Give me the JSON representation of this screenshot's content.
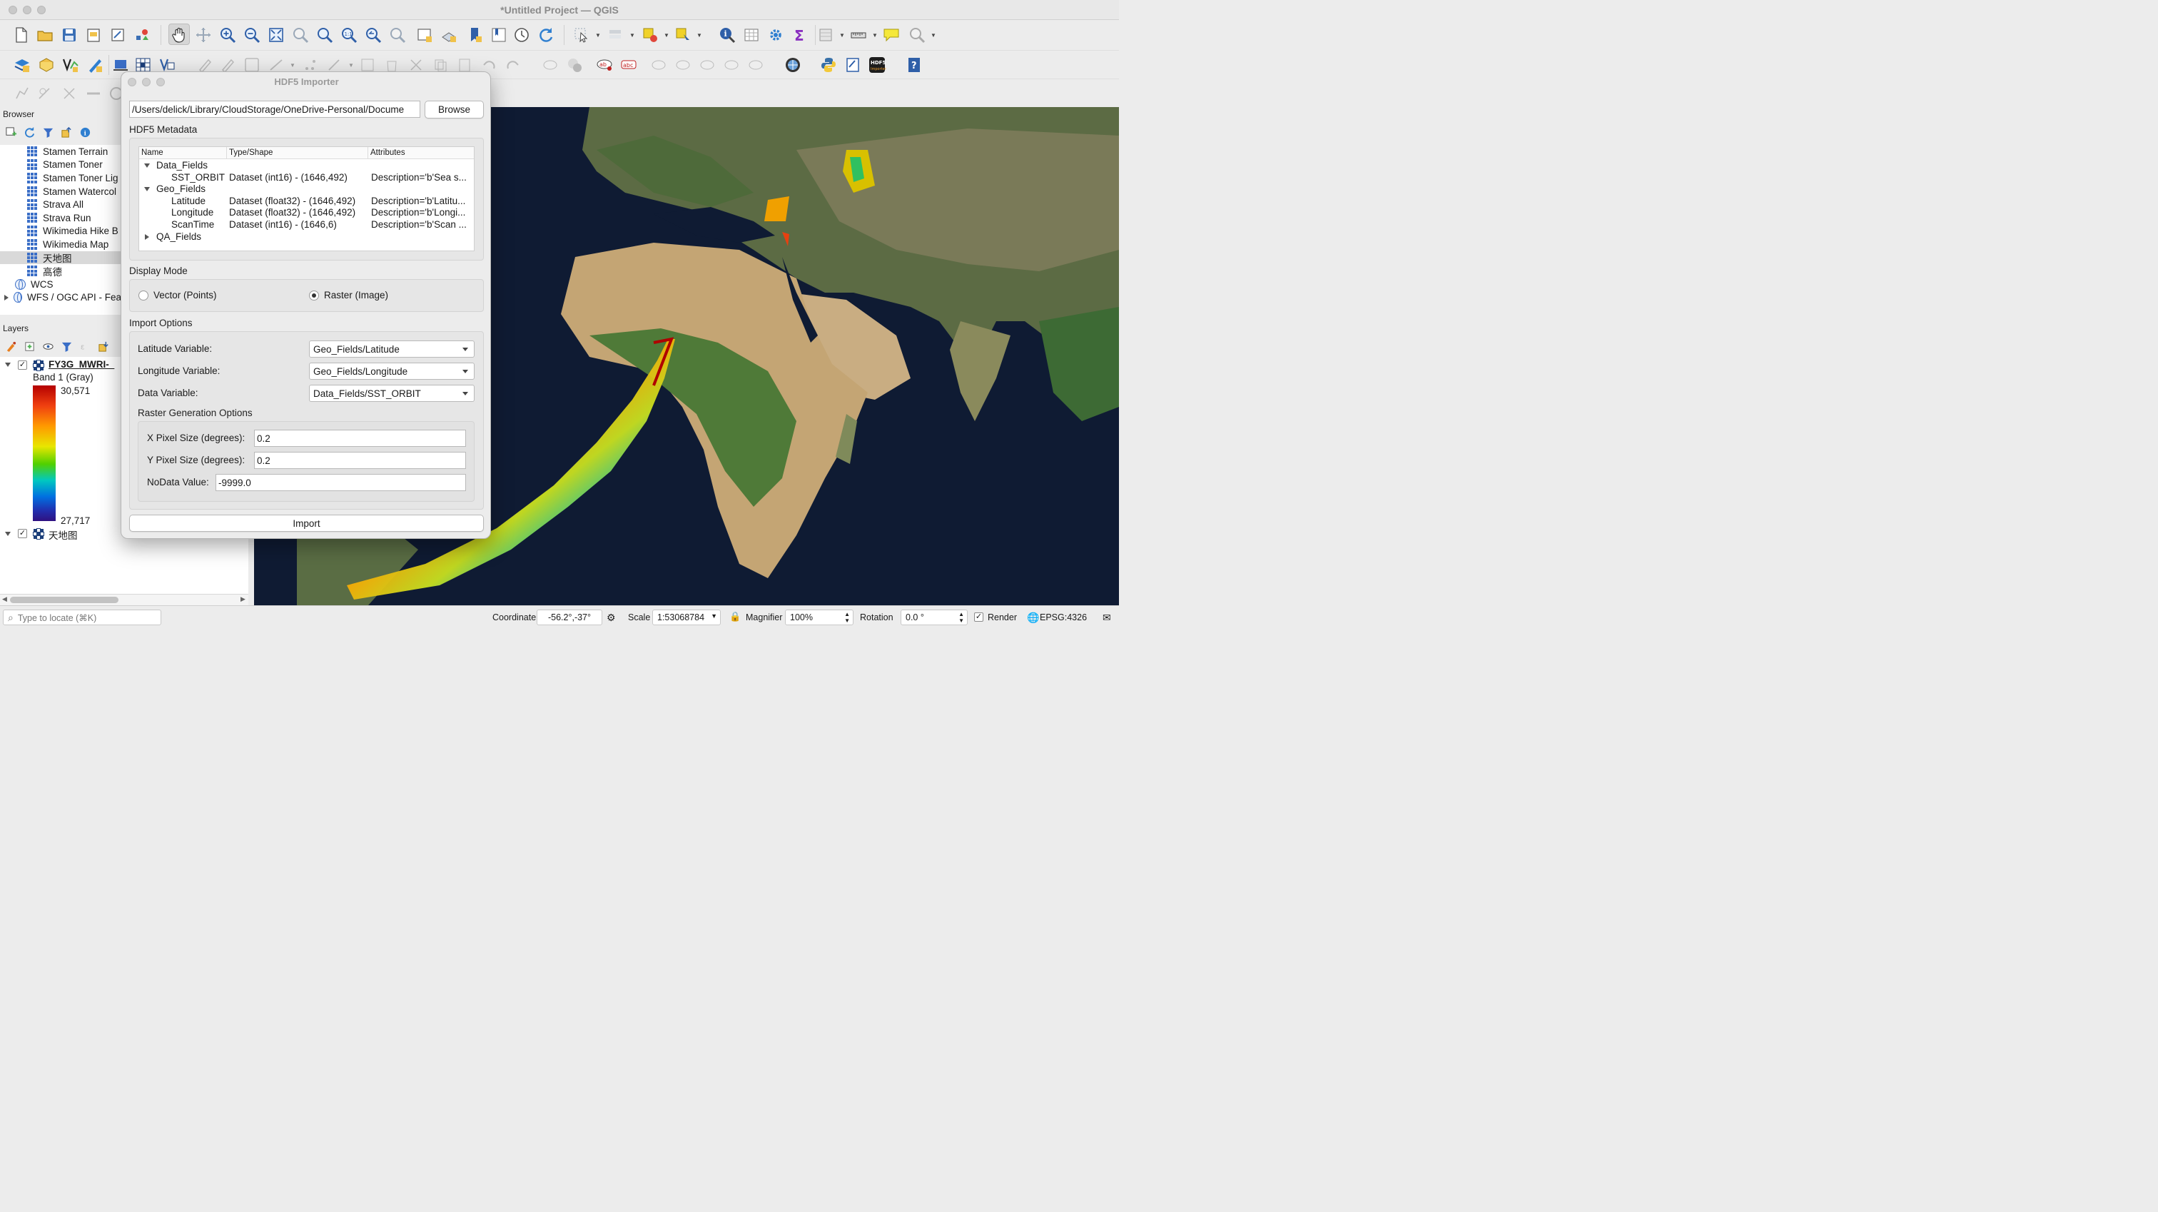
{
  "window": {
    "title": "*Untitled Project — QGIS"
  },
  "panels": {
    "browser": {
      "title": "Browser",
      "items": [
        {
          "label": "Stamen Terrain",
          "icon": "xyz-grid-icon"
        },
        {
          "label": "Stamen Toner",
          "icon": "xyz-grid-icon"
        },
        {
          "label": "Stamen Toner Lig",
          "icon": "xyz-grid-icon"
        },
        {
          "label": "Stamen Watercol",
          "icon": "xyz-grid-icon"
        },
        {
          "label": "Strava All",
          "icon": "xyz-grid-icon"
        },
        {
          "label": "Strava Run",
          "icon": "xyz-grid-icon"
        },
        {
          "label": "Wikimedia Hike B",
          "icon": "xyz-grid-icon"
        },
        {
          "label": "Wikimedia Map",
          "icon": "xyz-grid-icon"
        },
        {
          "label": "天地图",
          "icon": "xyz-grid-icon",
          "selected": true
        },
        {
          "label": "高德",
          "icon": "xyz-grid-icon"
        },
        {
          "label": "WCS",
          "icon": "globe-icon"
        },
        {
          "label": "WFS / OGC API - Fea",
          "icon": "globe-icon"
        }
      ]
    },
    "layers": {
      "title": "Layers",
      "layer1": {
        "name": "FY3G_MWRI-_",
        "band": "Band 1 (Gray)",
        "max": "30,571",
        "min": "27,717",
        "checked": true
      },
      "layer2": {
        "name": "天地图",
        "checked": true
      }
    }
  },
  "dialog": {
    "title": "HDF5 Importer",
    "path_value": "/Users/delick/Library/CloudStorage/OneDrive-Personal/Docume",
    "browse_label": "Browse",
    "metadata": {
      "title": "HDF5 Metadata",
      "columns": [
        "Name",
        "Type/Shape",
        "Attributes"
      ],
      "rows": [
        {
          "name": "Data_Fields",
          "type": "",
          "attr": "",
          "group": true,
          "expanded": true
        },
        {
          "name": "SST_ORBIT",
          "type": "Dataset (int16) - (1646,492)",
          "attr": "Description='b'Sea s..."
        },
        {
          "name": "Geo_Fields",
          "type": "",
          "attr": "",
          "group": true,
          "expanded": true
        },
        {
          "name": "Latitude",
          "type": "Dataset (float32) - (1646,492)",
          "attr": "Description='b'Latitu..."
        },
        {
          "name": "Longitude",
          "type": "Dataset (float32) - (1646,492)",
          "attr": "Description='b'Longi..."
        },
        {
          "name": "ScanTime",
          "type": "Dataset (int16) - (1646,6)",
          "attr": "Description='b'Scan ..."
        },
        {
          "name": "QA_Fields",
          "type": "",
          "attr": "",
          "group": true,
          "expanded": false
        }
      ]
    },
    "display_mode": {
      "title": "Display Mode",
      "vector_label": "Vector (Points)",
      "raster_label": "Raster (Image)",
      "selected": "raster"
    },
    "import_options": {
      "title": "Import Options",
      "lat_label": "Latitude Variable:",
      "lat_value": "Geo_Fields/Latitude",
      "lon_label": "Longitude Variable:",
      "lon_value": "Geo_Fields/Longitude",
      "data_label": "Data Variable:",
      "data_value": "Data_Fields/SST_ORBIT"
    },
    "raster_options": {
      "title": "Raster Generation Options",
      "xpix_label": "X Pixel Size (degrees):",
      "xpix_value": "0.2",
      "ypix_label": "Y Pixel Size (degrees):",
      "ypix_value": "0.2",
      "nodata_label": "NoData Value:",
      "nodata_value": "-9999.0"
    },
    "import_label": "Import"
  },
  "statusbar": {
    "locate_placeholder": "Type to locate (⌘K)",
    "coordinate_label": "Coordinate",
    "coordinate_value": "-56.2°,-37°",
    "scale_label": "Scale",
    "scale_value": "1:53068784",
    "magnifier_label": "Magnifier",
    "magnifier_value": "100%",
    "rotation_label": "Rotation",
    "rotation_value": "0.0 °",
    "render_label": "Render",
    "render_checked": true,
    "crs_label": "EPSG:4326"
  },
  "colors": {
    "accent": "#3a6ec7",
    "ocean": "#0f1b33",
    "ramp_high": "#b40000",
    "ramp_low": "#301080"
  }
}
